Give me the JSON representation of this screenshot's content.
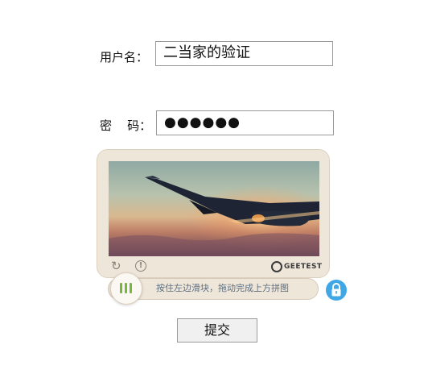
{
  "form": {
    "username_label": "用户名：",
    "username_value": "二当家的验证",
    "password_label": "密    码：",
    "password_value": "●●●●●●",
    "submit_label": "提交"
  },
  "captcha": {
    "slider_hint": "按住左边滑块，拖动完成上方拼图",
    "brand": "GEETEST",
    "icons": [
      "refresh-icon",
      "info-icon",
      "geetest-logo-icon",
      "slider-grip-icon",
      "lock-icon"
    ],
    "colors": {
      "panel_bg": "#efe6da",
      "grip_green": "#76b83d",
      "lock_blue": "#3fa7e6",
      "hint_text": "#5d6f7f"
    }
  }
}
